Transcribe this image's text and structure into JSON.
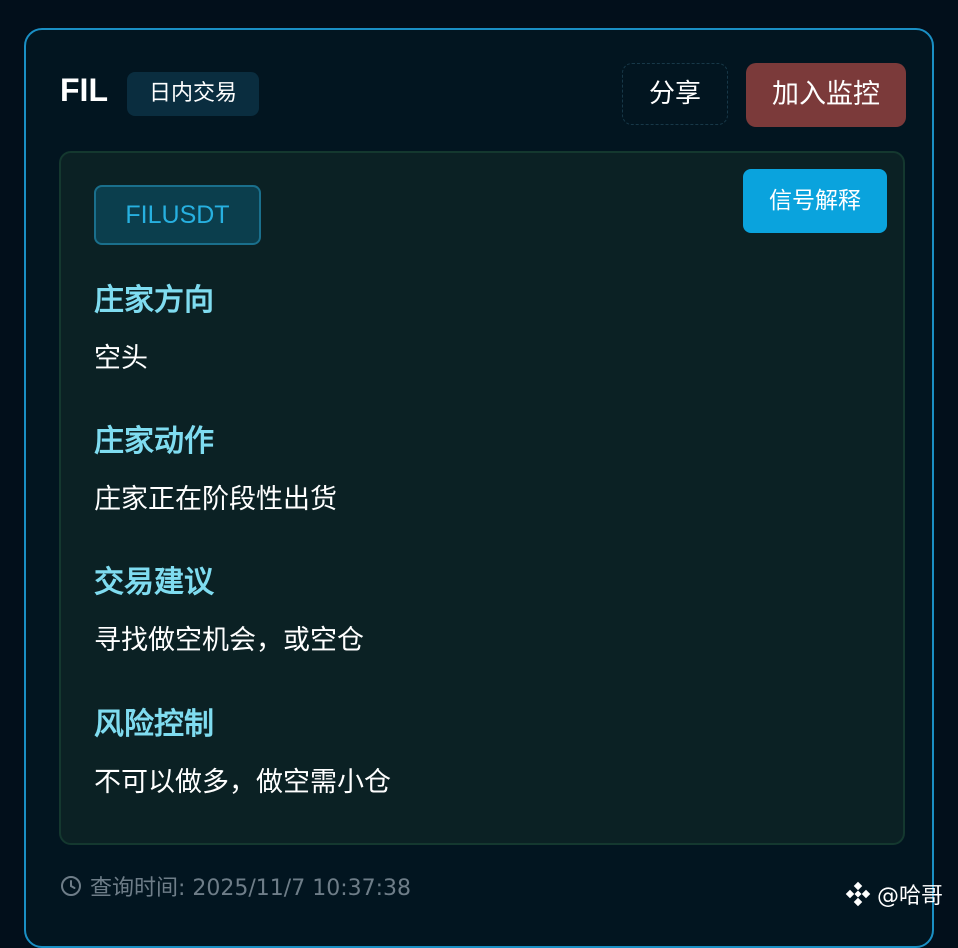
{
  "header": {
    "symbol": "FIL",
    "mode": "日内交易",
    "share_label": "分享",
    "monitor_label": "加入监控"
  },
  "panel": {
    "pair": "FILUSDT",
    "explain_label": "信号解释",
    "sections": [
      {
        "title": "庄家方向",
        "text": "空头"
      },
      {
        "title": "庄家动作",
        "text": "庄家正在阶段性出货"
      },
      {
        "title": "交易建议",
        "text": "寻找做空机会，或空仓"
      },
      {
        "title": "风险控制",
        "text": "不可以做多，做空需小仓"
      }
    ]
  },
  "footer": {
    "query_time": "查询时间: 2025/11/7 10:37:38"
  },
  "watermark": {
    "text": "@哈哥"
  },
  "icons": {
    "clock": "clock-icon",
    "logo": "binance-diamond-icon"
  },
  "colors": {
    "accent_border": "#1a8fc4",
    "section_title": "#7fdcf0",
    "monitor_button": "#7b3a3a",
    "explain_button": "#0aa3dd",
    "pair_text": "#27b0e0"
  }
}
